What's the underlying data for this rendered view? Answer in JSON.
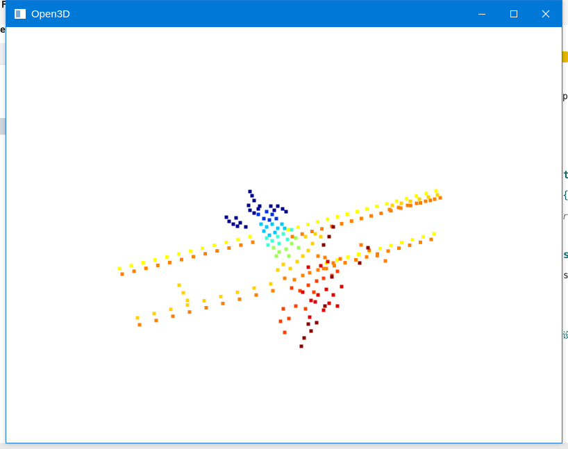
{
  "window": {
    "title": "Open3D",
    "minimize_icon": "minimize-icon",
    "maximize_icon": "maximize-icon",
    "close_icon": "close-icon"
  },
  "background_app": {
    "fragments": [
      {
        "text": "F",
        "cls": "black"
      },
      {
        "text": "e",
        "cls": "black"
      },
      {
        "text": "p",
        "cls": "black"
      },
      {
        "text": "t",
        "cls": ""
      },
      {
        "text": "{",
        "cls": ""
      },
      {
        "text": "r",
        "cls": "gray"
      },
      {
        "text": "s",
        "cls": ""
      },
      {
        "text": "s",
        "cls": "black"
      },
      {
        "text": "设",
        "cls": ""
      }
    ]
  },
  "point_cloud": {
    "colors": {
      "navy": "#00008b",
      "blue": "#0033e6",
      "cyan": "#00c8ff",
      "aqua": "#40ffd0",
      "green": "#9cff50",
      "yellow": "#ffff00",
      "gold": "#ffd200",
      "orange": "#ff8000",
      "red_orange": "#ff4000",
      "red": "#e00000",
      "dark_red": "#8b0000"
    }
  }
}
